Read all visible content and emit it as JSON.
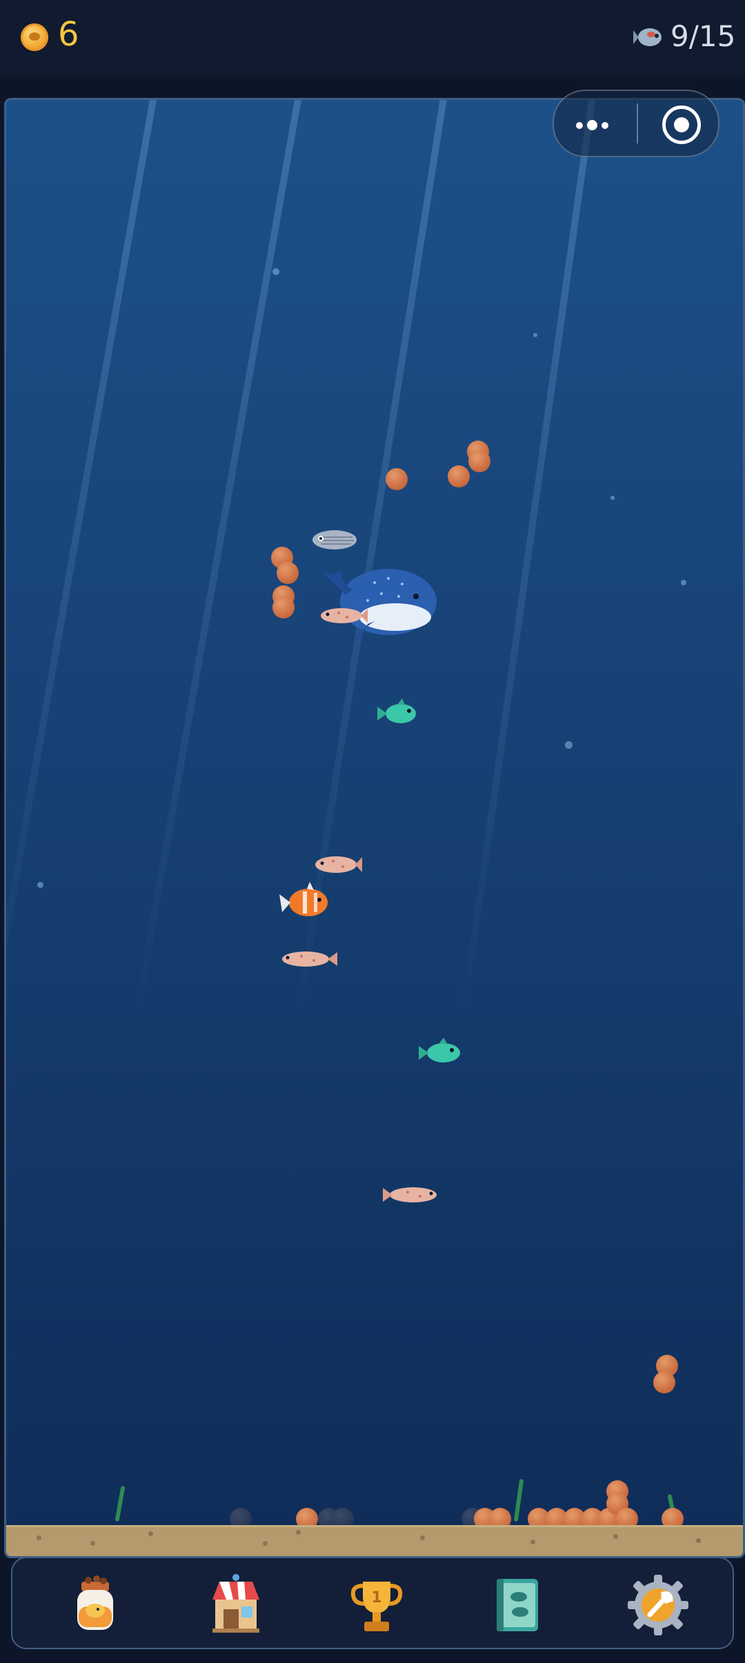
{
  "header": {
    "coins": "6",
    "fish_count": "9/15",
    "coin_icon": "coin-icon",
    "fish_icon": "fish-counter-icon"
  },
  "capsule": {
    "menu_icon": "more-dots-icon",
    "close_icon": "target-icon"
  },
  "tank": {
    "fish": [
      {
        "kind": "whale",
        "color": "#2b5fb0"
      },
      {
        "kind": "silver-stripe",
        "color": "#9aa7bd"
      },
      {
        "kind": "koi-pink",
        "color": "#e7b3a3"
      },
      {
        "kind": "teal",
        "color": "#3cc7a8"
      },
      {
        "kind": "koi-pink",
        "color": "#e7b3a3"
      },
      {
        "kind": "clownfish",
        "color": "#f07a2a"
      },
      {
        "kind": "koi-pink",
        "color": "#e7b3a3"
      },
      {
        "kind": "teal",
        "color": "#3cc7a8"
      },
      {
        "kind": "koi-pink",
        "color": "#e7b3a3"
      }
    ]
  },
  "bottom_nav": [
    {
      "name": "food-jar",
      "icon": "food-jar-icon"
    },
    {
      "name": "shop",
      "icon": "shop-icon"
    },
    {
      "name": "trophy",
      "icon": "trophy-icon"
    },
    {
      "name": "fish-book",
      "icon": "fish-book-icon"
    },
    {
      "name": "settings",
      "icon": "gear-wrench-icon"
    }
  ],
  "colors": {
    "coin_text": "#f5c542",
    "water_top": "#1d5089",
    "water_bottom": "#0f2c58",
    "sand": "#b49a6c",
    "pellet": "#c9683c"
  }
}
